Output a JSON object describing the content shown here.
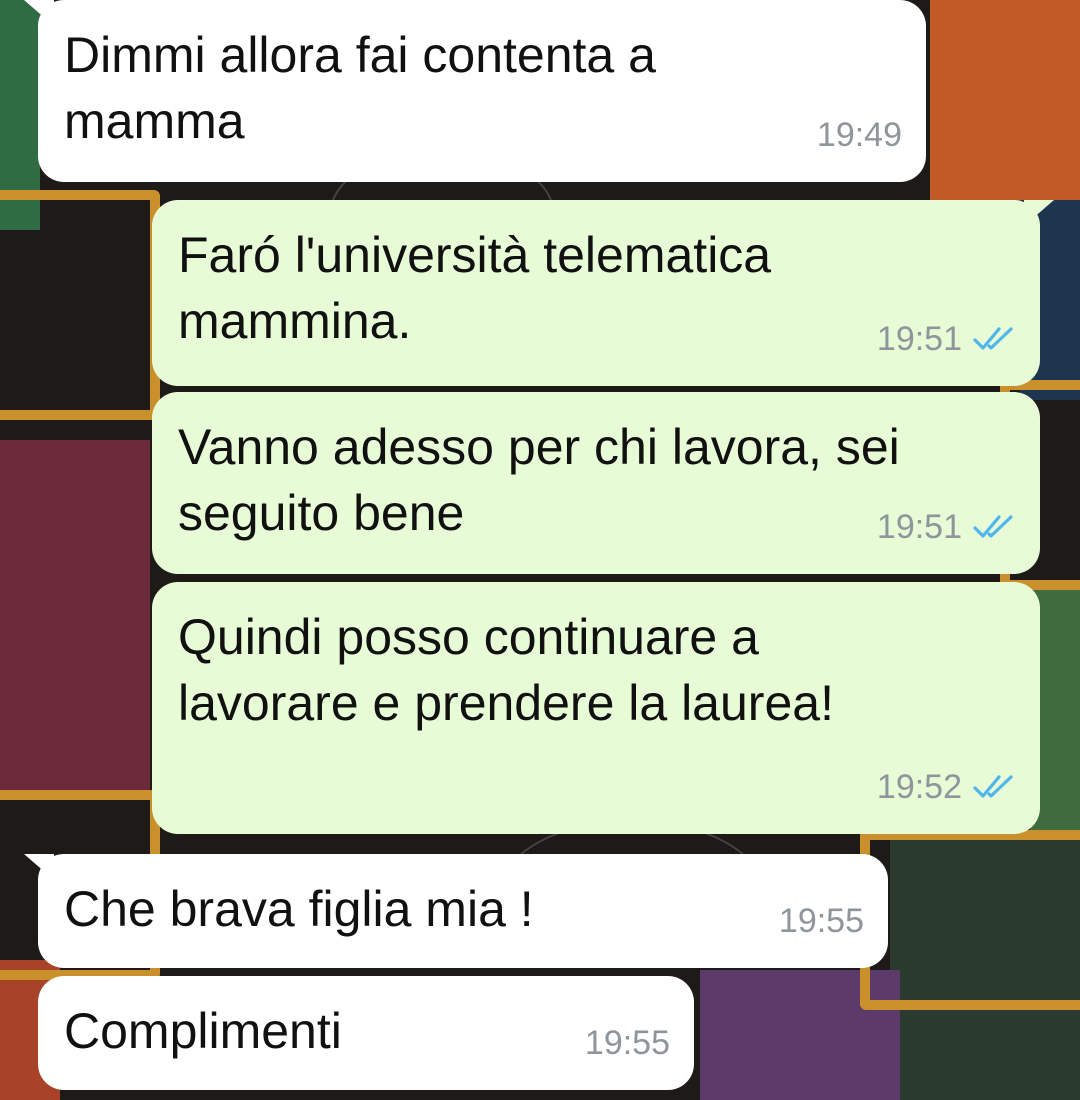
{
  "chat": {
    "messages": [
      {
        "direction": "incoming",
        "text": "Dimmi allora fai contenta a\nmamma",
        "time": "19:49"
      },
      {
        "direction": "outgoing",
        "text": "Faró l'università telematica\nmammina.",
        "time": "19:51",
        "status": "read"
      },
      {
        "direction": "outgoing",
        "text": "Vanno adesso per chi lavora, sei\nseguito bene",
        "time": "19:51",
        "status": "read"
      },
      {
        "direction": "outgoing",
        "text": "Quindi posso continuare a\nlavorare e prendere la laurea!",
        "time": "19:52",
        "status": "read"
      },
      {
        "direction": "incoming",
        "text": "Che brava figlia mia !",
        "time": "19:55"
      },
      {
        "direction": "incoming",
        "text": "Complimenti",
        "time": "19:55"
      }
    ]
  },
  "colors": {
    "incoming_bubble": "#ffffff",
    "outgoing_bubble": "#e7fcd6",
    "timestamp": "#8f959a",
    "read_ticks": "#4fb6ec",
    "wallpaper_frame_gold": "#c9902c"
  },
  "icons": {
    "read_receipt": "double-check-icon"
  }
}
